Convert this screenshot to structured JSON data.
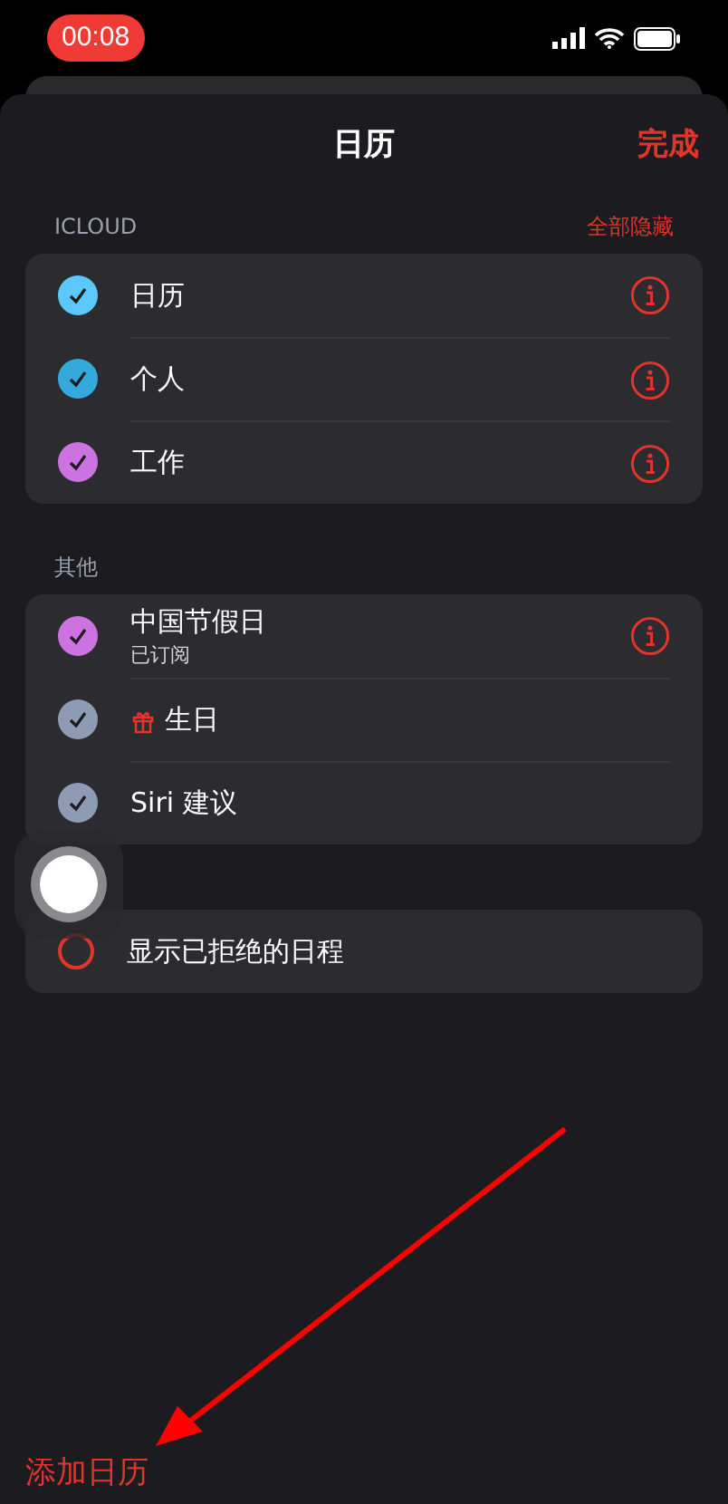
{
  "status_bar": {
    "time": "00:08"
  },
  "header": {
    "title": "日历",
    "done": "完成"
  },
  "sections": [
    {
      "title": "ICLOUD",
      "action": "全部隐藏",
      "items": [
        {
          "label": "日历",
          "checked": true,
          "color": "#5ac8fa",
          "info": true
        },
        {
          "label": "个人",
          "checked": true,
          "color": "#34aadc",
          "info": true
        },
        {
          "label": "工作",
          "checked": true,
          "color": "#cc73e1",
          "info": true
        }
      ]
    },
    {
      "title": "其他",
      "items": [
        {
          "label": "中国节假日",
          "subtitle": "已订阅",
          "checked": true,
          "color": "#cc73e1",
          "info": true
        },
        {
          "label": "生日",
          "checked": true,
          "color": "#8e9bb5",
          "info": false,
          "gift": true
        },
        {
          "label": "Siri 建议",
          "checked": true,
          "color": "#8e9bb5",
          "info": false
        }
      ]
    }
  ],
  "declined": {
    "label": "显示已拒绝的日程",
    "checked": false
  },
  "footer": {
    "add": "添加日历"
  }
}
